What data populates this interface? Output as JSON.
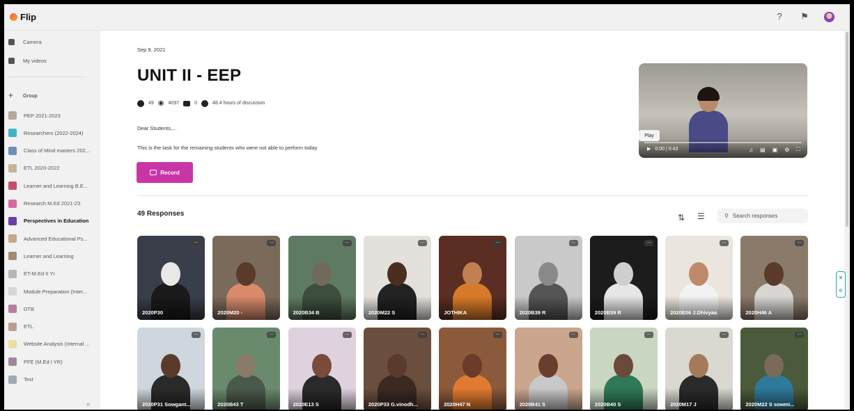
{
  "app": {
    "name": "Flip"
  },
  "header": {
    "help_icon": "?",
    "notification_icon": "bell",
    "avatar": "user"
  },
  "sidebar": {
    "nav": [
      {
        "label": "Camera",
        "icon": "camera-icon"
      },
      {
        "label": "My videos",
        "icon": "video-icon"
      }
    ],
    "group_label": "Group",
    "groups": [
      {
        "label": "PEP 2021-2023",
        "color": "#b9a79b"
      },
      {
        "label": "Researchers (2022-2024)",
        "color": "#42b3c6"
      },
      {
        "label": "Class of Mind masters 202...",
        "color": "#6d8fb8"
      },
      {
        "label": "ETL 2020-2022",
        "color": "#c9b299"
      },
      {
        "label": "Learner and Learning B.E...",
        "color": "#c84f6b"
      },
      {
        "label": "Research M.Ed 2021-23",
        "color": "#d46aa0"
      },
      {
        "label": "Perspectives in Education",
        "color": "#6a3fa8"
      },
      {
        "label": "Advanced Educational Ps...",
        "color": "#c6a78d"
      },
      {
        "label": "Learner and Learning",
        "color": "#a48a73"
      },
      {
        "label": "ET-M.Ed II Yr",
        "color": "#b2b8b6"
      },
      {
        "label": "Module Preparation (Inter...",
        "color": "#d6d6d6"
      },
      {
        "label": "DTB",
        "color": "#b77f9b"
      },
      {
        "label": "ETL",
        "color": "#b9a08d"
      },
      {
        "label": "Website Analysis (Internal ...",
        "color": "#e8dfa1"
      },
      {
        "label": "PFE (M.Ed I YR)",
        "color": "#9e8a9f"
      },
      {
        "label": "Test",
        "color": "#a3a9b4"
      }
    ],
    "collapse": "«"
  },
  "topic": {
    "date": "Sep 9, 2021",
    "title": "UNIT II - EEP",
    "stats": {
      "videos": "49",
      "views": "4097",
      "comments": "0",
      "discussion": "48.4 hours of discussion"
    },
    "greeting": "Dear Students,...",
    "description": "This is the task for the remaining students who were not able to perform today",
    "record_label": "Record"
  },
  "video": {
    "tooltip": "Play",
    "time": "0:00 | 0:43"
  },
  "responses": {
    "title": "49 Responses",
    "search_placeholder": "Search responses",
    "items": [
      {
        "name": "2020P30",
        "bg": "#3a3e4a",
        "skin": "#e8e8e8",
        "shirt": "#1a1a1a"
      },
      {
        "name": "2020M20 -",
        "bg": "#7a6a5a",
        "skin": "#5a3a2a",
        "shirt": "#d98a6a"
      },
      {
        "name": "2020B34 B",
        "bg": "#5e7a62",
        "skin": "#6f6a5a",
        "shirt": "#3e4e3e"
      },
      {
        "name": "2020M22 S",
        "bg": "#e4e1dc",
        "skin": "#4a2e1e",
        "shirt": "#222"
      },
      {
        "name": "JOTHIKA",
        "bg": "#5a2e22",
        "skin": "#c08050",
        "shirt": "#d87a2a"
      },
      {
        "name": "2020B39 R",
        "bg": "#c9c9c9",
        "skin": "#8a8a8a",
        "shirt": "#555"
      },
      {
        "name": "2020B39 R",
        "bg": "#1c1c1c",
        "skin": "#cfcfcf",
        "shirt": "#e6e6e6"
      },
      {
        "name": "2020E06 J.Dhivyaa",
        "bg": "#eae6df",
        "skin": "#c08a6a",
        "shirt": "#f2f2f2"
      },
      {
        "name": "2020H46 A",
        "bg": "#8a7a6a",
        "skin": "#5a3a2a",
        "shirt": "#d8d6d2"
      },
      {
        "name": "2020P31 Sowgant...",
        "bg": "#cfd6dd",
        "skin": "#5a3a2a",
        "shirt": "#2a2a2a"
      },
      {
        "name": "2020B43 T",
        "bg": "#6a8a6e",
        "skin": "#8a7a6a",
        "shirt": "#4a5a4a"
      },
      {
        "name": "2020E13 S",
        "bg": "#ded2de",
        "skin": "#7a4a3a",
        "shirt": "#2a2a2a"
      },
      {
        "name": "2020P33 G.vinodh...",
        "bg": "#6a4e3e",
        "skin": "#5a3a2a",
        "shirt": "#3a2a22"
      },
      {
        "name": "2020H47 N",
        "bg": "#8a5a3a",
        "skin": "#6a3a2a",
        "shirt": "#e07a30"
      },
      {
        "name": "2020B41 S",
        "bg": "#caa68e",
        "skin": "#6a3e2e",
        "shirt": "#c8c8c8"
      },
      {
        "name": "2020B40 S",
        "bg": "#c9d6c2",
        "skin": "#6a4a3a",
        "shirt": "#2f7a56"
      },
      {
        "name": "2020M17 J",
        "bg": "#d9d9d1",
        "skin": "#a47a5a",
        "shirt": "#2a2a2a"
      },
      {
        "name": "2020M22 S sowmi...",
        "bg": "#4a5a3a",
        "skin": "#7a6a5a",
        "shirt": "#2e7a9a"
      }
    ]
  }
}
